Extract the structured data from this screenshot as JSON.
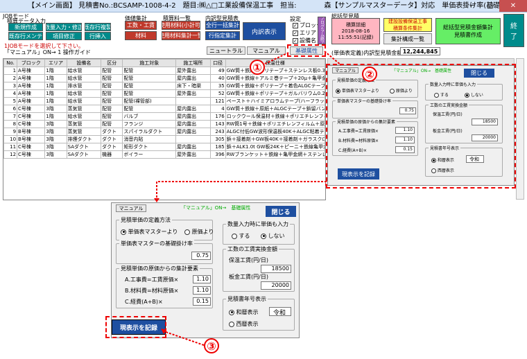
{
  "window": {
    "title": "【メイン画面】 見積書No.:BCSAMP-1008-4-2　題目:㈱△□工業設備保温工事　担当:　　　　森【サンプルマスターデータ】対応　単価表掛け率(基礎属性)：0.75"
  },
  "toolbar": {
    "job_mode_label": "JOBモード",
    "data_input_label": "積算データ入力",
    "new_create": "新規作成",
    "existing_menu": "既存行メンテ",
    "qty_input": "数量入力・修正",
    "item_correct": "項目修正",
    "existing_copy": "既存行複製",
    "line_insert": "行挿入",
    "price_calc_label": "価値集計",
    "construction": "工数・工賃",
    "materials": "材料",
    "estimate_list_label": "積算料一覧",
    "use_material": "使用材料(小計可)",
    "use_material_list": "使用材料集計一覧",
    "internal_label": "内訳型見積表",
    "all_row_calc": "全行一括集計",
    "row_disp_setting": "行指定集計",
    "internal_disp": "内訳表示",
    "settings_label": "設定",
    "cb_block": "ブロック",
    "cb_area": "エリア",
    "cb_device": "設備名",
    "program_end": "プログラム終了",
    "summary_label": "総括型見積",
    "calc_detail_line1": "積算詳細",
    "calc_detail_line2": "2018-08-16",
    "calc_detail_line3": "11:55:51(記録)",
    "construct_total_line1": "建設設備保温工事",
    "construct_total_line2": "積算条件集計",
    "sum_config": "集計構成一覧",
    "summary_create_line1": "総括型見積金額集計",
    "summary_create_line2": "見積書作成",
    "end_line1": "終",
    "end_line2": "了",
    "hint_line1": "1JOBモードを選択して下さい。",
    "hint_line2": "「マニュアル」ON→ 1 操作ガイド",
    "neutral": "ニュートラル",
    "manual": "マニュアル",
    "basic_attr": "基礎属性",
    "amount_label": "(単価表定義)内訳型見積金額",
    "amount_value": "12,244,845"
  },
  "grid": {
    "headers": [
      "No.",
      "ブロック",
      "エリア",
      "設備名",
      "区分",
      "施工対象",
      "施工場所",
      "口径",
      "保温仕様"
    ],
    "rows": [
      [
        "1",
        "A号棟",
        "1階",
        "給水管",
        "配管",
        "配管",
        "屋外露出",
        "49",
        "GW筒＋鉄線＋ポリテープ＋ステンレス板0.3t"
      ],
      [
        "2",
        "A号棟",
        "1階",
        "給水管",
        "配管",
        "配管",
        "屋内露出",
        "40",
        "GW筒＋鉄線＋アルミ巻テープ＋20μ＋亀甲金網0.5t"
      ],
      [
        "3",
        "A号棟",
        "1階",
        "排水管",
        "配管",
        "配管",
        "床下・暗渠",
        "35",
        "GW筒＋鉄線＋ポリテープ＋着色ALGCテープ"
      ],
      [
        "4",
        "A号棟",
        "1階",
        "給水管",
        "配管",
        "配管",
        "屋外露出",
        "52",
        "GW筒＋鉄線＋ポリテープ＋ガルバリウム0.27~0.35t"
      ],
      [
        "5",
        "A号棟",
        "1階",
        "給水管",
        "配管",
        "配管(裸管部)",
        "",
        "121",
        "ペースト＋ハイミアロラムテープ(ハーフラップ)＋ナイスタックテープ(ペバ)"
      ],
      [
        "6",
        "C号棟",
        "3階",
        "蒸気管",
        "配管",
        "配管",
        "屋内露出",
        "4",
        "GW筒＋鉄線＋原紙＋ALGCテープ＋鋲留バンド"
      ],
      [
        "7",
        "C号棟",
        "1階",
        "給水管",
        "配管",
        "バルブ",
        "屋内露出",
        "176",
        "ロックウール保温材＋鉄線＋ポリエチレンフィルム＋アルミ板0.6t"
      ],
      [
        "8",
        "C号棟",
        "3階",
        "蒸気管",
        "配管",
        "フランジ",
        "屋内露出",
        "143",
        "RW筒1号＋鉄線＋ポリエチレンフィルム＋原紙＋アルミガラス"
      ],
      [
        "9",
        "B号棟",
        "3階",
        "蒸気管",
        "ダクト",
        "スパイラルダクト",
        "屋内露出",
        "243",
        "ALGC付低GW波形保温板40K＋ALGC粘着テープ"
      ],
      [
        "10",
        "B号棟",
        "3階",
        "排煙ダクト",
        "ダクト",
        "消音内貼",
        "",
        "305",
        "鋲＋接着剤＋GW板40K＋接着剤＋ガラスクロス＋ピーニ"
      ],
      [
        "11",
        "C号棟",
        "3階",
        "SAダクト",
        "ダクト",
        "矩形ダクト",
        "屋内露出",
        "185",
        "鋲＋ALK1.0t GW板24K＋ピーニ＋鉄線亀甲金網"
      ],
      [
        "12",
        "C号棟",
        "3階",
        "SAダクト",
        "機器",
        "ボイラー",
        "屋外露出",
        "396",
        "RWブランケット＋鉄線＋亀甲金網＋ステンレス板0.3t"
      ]
    ]
  },
  "dialog": {
    "manual": "マニュアル",
    "caption": "「マニュアル」ON→　基礎属性",
    "close": "閉じる",
    "method_group": "見積単価の定義方法",
    "method_opt1": "単価表マスターより",
    "method_opt2": "原価より",
    "rate_group": "単価表マスターの基礎掛け率",
    "rate_value": "0.75",
    "cost_group": "見積単価の原価からの集計要素",
    "cost_a_label": "A.工事費=工賃原価×",
    "cost_a_value": "1.10",
    "cost_b_label": "B.材料費=材料原価×",
    "cost_b_value": "1.10",
    "cost_c_label": "C.経費(A+B)×",
    "cost_c_value": "0.15",
    "qty_group": "数量入力時に単価も入力",
    "qty_opt1": "する",
    "qty_opt2": "しない",
    "wage_group": "工数の工賃実換金額",
    "wage_hoon_label": "保温工賃(円/日)",
    "wage_hoon_value": "18500",
    "wage_ita_label": "板金工賃(円/日)",
    "wage_ita_value": "20000",
    "year_group": "見積書年号表示",
    "year_opt1": "和暦表示",
    "year_value": "令和",
    "year_opt2": "西暦表示",
    "record": "現表示を記録"
  },
  "callouts": {
    "c1": "①",
    "c2": "②",
    "c3": "③"
  },
  "colors": {
    "annotation": "#e00000",
    "title_blue": "#1e4fa0",
    "teal": "#008b8b"
  }
}
